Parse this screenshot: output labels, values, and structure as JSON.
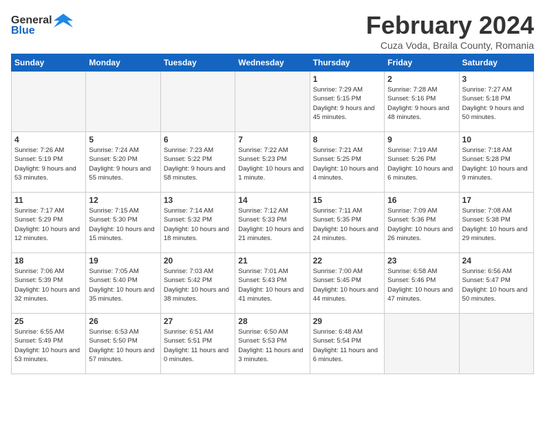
{
  "header": {
    "logo_line1": "General",
    "logo_line2": "Blue",
    "title": "February 2024",
    "subtitle": "Cuza Voda, Braila County, Romania"
  },
  "days_of_week": [
    "Sunday",
    "Monday",
    "Tuesday",
    "Wednesday",
    "Thursday",
    "Friday",
    "Saturday"
  ],
  "weeks": [
    [
      {
        "day": "",
        "info": ""
      },
      {
        "day": "",
        "info": ""
      },
      {
        "day": "",
        "info": ""
      },
      {
        "day": "",
        "info": ""
      },
      {
        "day": "1",
        "info": "Sunrise: 7:29 AM\nSunset: 5:15 PM\nDaylight: 9 hours\nand 45 minutes."
      },
      {
        "day": "2",
        "info": "Sunrise: 7:28 AM\nSunset: 5:16 PM\nDaylight: 9 hours\nand 48 minutes."
      },
      {
        "day": "3",
        "info": "Sunrise: 7:27 AM\nSunset: 5:18 PM\nDaylight: 9 hours\nand 50 minutes."
      }
    ],
    [
      {
        "day": "4",
        "info": "Sunrise: 7:26 AM\nSunset: 5:19 PM\nDaylight: 9 hours\nand 53 minutes."
      },
      {
        "day": "5",
        "info": "Sunrise: 7:24 AM\nSunset: 5:20 PM\nDaylight: 9 hours\nand 55 minutes."
      },
      {
        "day": "6",
        "info": "Sunrise: 7:23 AM\nSunset: 5:22 PM\nDaylight: 9 hours\nand 58 minutes."
      },
      {
        "day": "7",
        "info": "Sunrise: 7:22 AM\nSunset: 5:23 PM\nDaylight: 10 hours\nand 1 minute."
      },
      {
        "day": "8",
        "info": "Sunrise: 7:21 AM\nSunset: 5:25 PM\nDaylight: 10 hours\nand 4 minutes."
      },
      {
        "day": "9",
        "info": "Sunrise: 7:19 AM\nSunset: 5:26 PM\nDaylight: 10 hours\nand 6 minutes."
      },
      {
        "day": "10",
        "info": "Sunrise: 7:18 AM\nSunset: 5:28 PM\nDaylight: 10 hours\nand 9 minutes."
      }
    ],
    [
      {
        "day": "11",
        "info": "Sunrise: 7:17 AM\nSunset: 5:29 PM\nDaylight: 10 hours\nand 12 minutes."
      },
      {
        "day": "12",
        "info": "Sunrise: 7:15 AM\nSunset: 5:30 PM\nDaylight: 10 hours\nand 15 minutes."
      },
      {
        "day": "13",
        "info": "Sunrise: 7:14 AM\nSunset: 5:32 PM\nDaylight: 10 hours\nand 18 minutes."
      },
      {
        "day": "14",
        "info": "Sunrise: 7:12 AM\nSunset: 5:33 PM\nDaylight: 10 hours\nand 21 minutes."
      },
      {
        "day": "15",
        "info": "Sunrise: 7:11 AM\nSunset: 5:35 PM\nDaylight: 10 hours\nand 24 minutes."
      },
      {
        "day": "16",
        "info": "Sunrise: 7:09 AM\nSunset: 5:36 PM\nDaylight: 10 hours\nand 26 minutes."
      },
      {
        "day": "17",
        "info": "Sunrise: 7:08 AM\nSunset: 5:38 PM\nDaylight: 10 hours\nand 29 minutes."
      }
    ],
    [
      {
        "day": "18",
        "info": "Sunrise: 7:06 AM\nSunset: 5:39 PM\nDaylight: 10 hours\nand 32 minutes."
      },
      {
        "day": "19",
        "info": "Sunrise: 7:05 AM\nSunset: 5:40 PM\nDaylight: 10 hours\nand 35 minutes."
      },
      {
        "day": "20",
        "info": "Sunrise: 7:03 AM\nSunset: 5:42 PM\nDaylight: 10 hours\nand 38 minutes."
      },
      {
        "day": "21",
        "info": "Sunrise: 7:01 AM\nSunset: 5:43 PM\nDaylight: 10 hours\nand 41 minutes."
      },
      {
        "day": "22",
        "info": "Sunrise: 7:00 AM\nSunset: 5:45 PM\nDaylight: 10 hours\nand 44 minutes."
      },
      {
        "day": "23",
        "info": "Sunrise: 6:58 AM\nSunset: 5:46 PM\nDaylight: 10 hours\nand 47 minutes."
      },
      {
        "day": "24",
        "info": "Sunrise: 6:56 AM\nSunset: 5:47 PM\nDaylight: 10 hours\nand 50 minutes."
      }
    ],
    [
      {
        "day": "25",
        "info": "Sunrise: 6:55 AM\nSunset: 5:49 PM\nDaylight: 10 hours\nand 53 minutes."
      },
      {
        "day": "26",
        "info": "Sunrise: 6:53 AM\nSunset: 5:50 PM\nDaylight: 10 hours\nand 57 minutes."
      },
      {
        "day": "27",
        "info": "Sunrise: 6:51 AM\nSunset: 5:51 PM\nDaylight: 11 hours\nand 0 minutes."
      },
      {
        "day": "28",
        "info": "Sunrise: 6:50 AM\nSunset: 5:53 PM\nDaylight: 11 hours\nand 3 minutes."
      },
      {
        "day": "29",
        "info": "Sunrise: 6:48 AM\nSunset: 5:54 PM\nDaylight: 11 hours\nand 6 minutes."
      },
      {
        "day": "",
        "info": ""
      },
      {
        "day": "",
        "info": ""
      }
    ]
  ]
}
